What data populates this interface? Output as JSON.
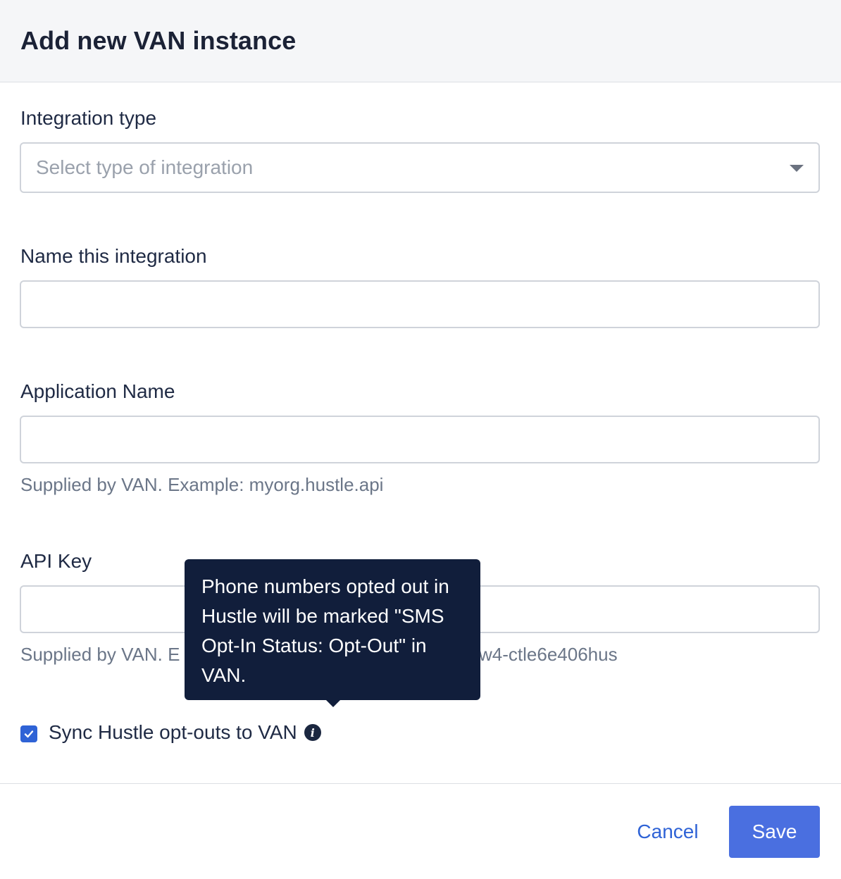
{
  "modal": {
    "title": "Add new VAN instance"
  },
  "form": {
    "integration_type": {
      "label": "Integration type",
      "placeholder": "Select type of integration"
    },
    "integration_name": {
      "label": "Name this integration",
      "value": ""
    },
    "application_name": {
      "label": "Application Name",
      "value": "",
      "help": "Supplied by VAN. Example: myorg.hustle.api"
    },
    "api_key": {
      "label": "API Key",
      "value": "",
      "help_start": "Supplied by VAN. E",
      "help_end": "w4-ctle6e406hus"
    },
    "sync_optouts": {
      "label": "Sync Hustle opt-outs to VAN",
      "checked": true,
      "info_icon": "info-icon"
    }
  },
  "tooltip": {
    "text": "Phone numbers opted out in Hustle will be marked \"SMS Opt-In Status: Opt-Out\" in VAN."
  },
  "footer": {
    "cancel_label": "Cancel",
    "save_label": "Save"
  },
  "colors": {
    "primary": "#4a6fe0",
    "link": "#2f63d6",
    "tooltip_bg": "#111e3b",
    "header_bg": "#f5f6f8"
  }
}
